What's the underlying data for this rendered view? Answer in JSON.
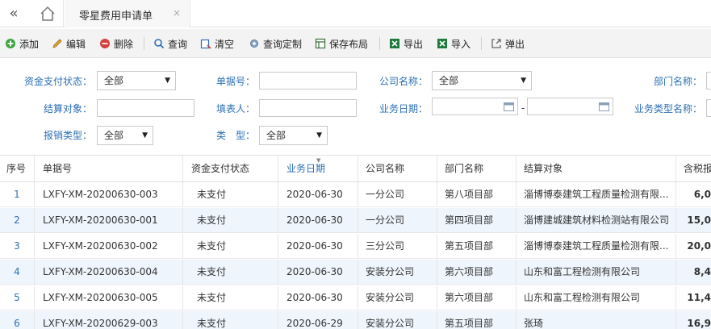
{
  "tabs": {
    "active_label": "零星费用申请单",
    "close": "×"
  },
  "toolbar": {
    "add": "添加",
    "edit": "编辑",
    "delete": "删除",
    "query": "查询",
    "clear": "清空",
    "custom_query": "查询定制",
    "save_layout": "保存布局",
    "export": "导出",
    "import": "导入",
    "popup": "弹出"
  },
  "filters": {
    "fund_status_label": "资金支付状态：",
    "fund_status_value": "全部",
    "doc_no_label": "单据号：",
    "company_label": "公司名称：",
    "company_value": "全部",
    "dept_label": "部门名称：",
    "settle_label": "结算对象：",
    "filler_label": "填表人：",
    "biz_date_label": "业务日期：",
    "date_sep": "-",
    "biz_type_label": "业务类型名称：",
    "reimb_type_label": "报销类型：",
    "reimb_type_value": "全部",
    "type_label": "类　型：",
    "type_value": "全部"
  },
  "grid": {
    "headers": [
      "序号",
      "单据号",
      "资金支付状态",
      "业务日期",
      "公司名称",
      "部门名称",
      "结算对象",
      "含税报"
    ],
    "rows": [
      [
        "1",
        "LXFY-XM-20200630-003",
        "未支付",
        "2020-06-30",
        "一分公司",
        "第八项目部",
        "淄博博泰建筑工程质量检测有限...",
        "6,0"
      ],
      [
        "2",
        "LXFY-XM-20200630-001",
        "未支付",
        "2020-06-30",
        "一分公司",
        "第四项目部",
        "淄博建城建筑材料检测站有限公司",
        "15,0"
      ],
      [
        "3",
        "LXFY-XM-20200630-002",
        "未支付",
        "2020-06-30",
        "三分公司",
        "第五项目部",
        "淄博博泰建筑工程质量检测有限...",
        "20,0"
      ],
      [
        "4",
        "LXFY-XM-20200630-004",
        "未支付",
        "2020-06-30",
        "安装分公司",
        "第六项目部",
        "山东和富工程检测有限公司",
        "8,4"
      ],
      [
        "5",
        "LXFY-XM-20200630-005",
        "未支付",
        "2020-06-30",
        "安装分公司",
        "第六项目部",
        "山东和富工程检测有限公司",
        "11,4"
      ],
      [
        "6",
        "LXFY-XM-20200629-003",
        "未支付",
        "2020-06-29",
        "安装分公司",
        "第五项目部",
        "张琦",
        "16,9"
      ]
    ]
  }
}
